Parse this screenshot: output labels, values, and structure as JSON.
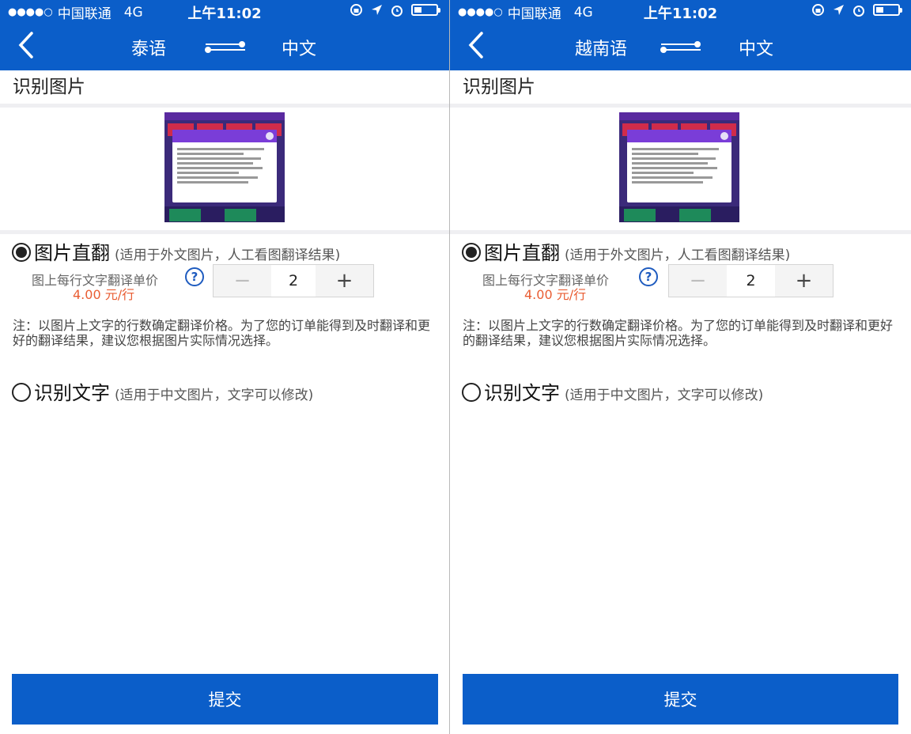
{
  "status": {
    "dots": "●●●●○",
    "carrier": "中国联通",
    "network": "4G",
    "time": "上午11:02"
  },
  "common": {
    "section_title": "识别图片",
    "option1": {
      "label": "图片直翻",
      "hint": "(适用于外文图片，人工看图翻译结果)"
    },
    "price_label": "图上每行文字翻译单价",
    "price_value": "4.00 元/行",
    "help": "?",
    "quantity": "2",
    "minus": "−",
    "plus": "+",
    "note": "注：以图片上文字的行数确定翻译价格。为了您的订单能得到及时翻译和更好的翻译结果，建议您根据图片实际情况选择。",
    "option2": {
      "label": "识别文字",
      "hint": "(适用于中文图片，文字可以修改)"
    },
    "submit": "提交"
  },
  "panels": [
    {
      "source_lang": "泰语",
      "target_lang": "中文"
    },
    {
      "source_lang": "越南语",
      "target_lang": "中文"
    }
  ],
  "colors": {
    "brand": "#0b5ec9",
    "price": "#e95d33"
  }
}
